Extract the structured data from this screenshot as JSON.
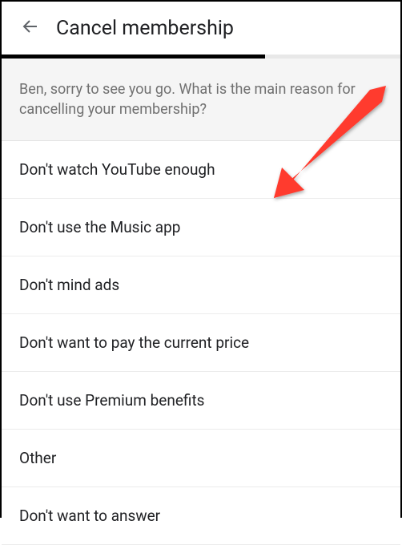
{
  "header": {
    "title": "Cancel membership"
  },
  "progress": {
    "percent": 66
  },
  "prompt": {
    "text": "Ben, sorry to see you go. What is the main reason for cancelling your membership?"
  },
  "options": [
    {
      "label": "Don't watch YouTube enough"
    },
    {
      "label": "Don't use the Music app"
    },
    {
      "label": "Don't mind ads"
    },
    {
      "label": "Don't want to pay the current price"
    },
    {
      "label": "Don't use Premium benefits"
    },
    {
      "label": "Other"
    },
    {
      "label": "Don't want to answer"
    }
  ],
  "annotation": {
    "color": "#ff3b2f",
    "target_option_index": 0
  }
}
